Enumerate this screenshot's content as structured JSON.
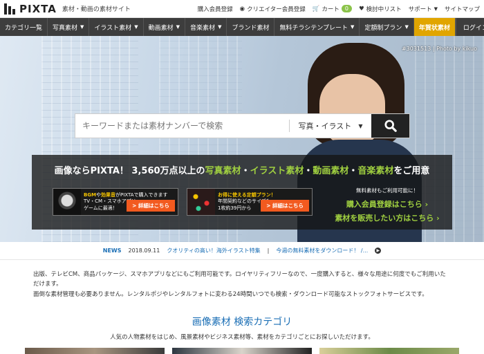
{
  "header": {
    "logo_text": "PIXTA",
    "tagline": "素材・動画の素材サイト",
    "links": [
      {
        "label": "購入会員登録",
        "icon": "none"
      },
      {
        "label": "クリエイター会員登録",
        "icon": "camera-icon"
      },
      {
        "label": "カート",
        "icon": "cart-icon",
        "badge": "0"
      },
      {
        "label": "検討中リスト",
        "icon": "heart-icon"
      },
      {
        "label": "サポート",
        "icon": "caret-down"
      },
      {
        "label": "サイトマップ",
        "icon": "none"
      }
    ]
  },
  "nav": {
    "items": [
      "カテゴリ一覧",
      "写真素材",
      "イラスト素材",
      "動画素材",
      "音楽素材",
      "ブランド素材",
      "無料チラシテンプレート",
      "定額制プラン",
      "年賀状素材"
    ],
    "login": "ログイン"
  },
  "hero": {
    "credit": "#3031513 | Photo by kikuo",
    "search_placeholder": "キーワードまたは素材ナンバーで検索",
    "search_type": "写真・イラスト",
    "promo": {
      "head_pre": "画像ならPIXTA！ 3,560万点以上の",
      "head_cat1": "写真素材",
      "head_dot": "・",
      "head_cat2": "イラスト素材",
      "head_cat3": "動画素材",
      "head_cat4": "音楽素材",
      "head_post": "をご用意",
      "card1_line1_a": "BGM",
      "card1_line1_b": "や",
      "card1_line1_c": "効果音",
      "card1_line1_d": "がPIXTAで購入できます",
      "card1_line2": "TV・CM・スマホアプリ・",
      "card1_line3": "ゲームに最適！",
      "card1_btn": "> 詳細はこちら",
      "card2_line1": "お得に使える定額プラン！",
      "card2_line2": "年間契約などのサイズも",
      "card2_line3": "1枚約39円から",
      "card2_btn": "> 詳細はこちら",
      "right_small": "無料素材もご利用可能に！",
      "right_link1": "購入会員登録はこちら ›",
      "right_link2": "素材を販売したい方はこちら ›"
    }
  },
  "news": {
    "label": "NEWS",
    "date": "2018.09.11",
    "link1": "クオリティの高い！海外イラスト特集",
    "sep": "|",
    "link2": "今週の無料素材をダウンロード！ /..."
  },
  "intro": {
    "line1": "出版、テレビCM、商品パッケージ、スマホアプリなどにもご利用可能です。ロイヤリティフリーなので、一度購入すると、様々な用途に何度でもご利用いただけます。",
    "line2": "面倒な素材管理も必要ありません。レンタルポジやレンタルフォトに変わる24時間いつでも検索・ダウンロード可能なストックフォトサービスです。"
  },
  "category_section": {
    "title": "画像素材 検索カテゴリ",
    "subtitle": "人気の人物素材をはじめ、風景素材やビジネス素材等、素材をカテゴリごとにお探しいただけます。"
  }
}
